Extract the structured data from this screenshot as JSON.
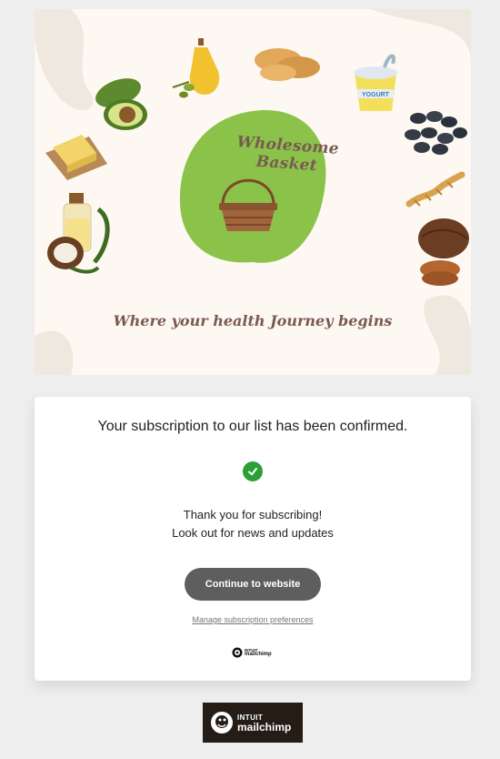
{
  "banner": {
    "brand_name": "Wholesome Basket",
    "tagline": "Where your health Journey begins",
    "bottle_label": "YOGURT"
  },
  "card": {
    "confirmation_message": "Your subscription to our list has been confirmed.",
    "thanks_line_1": "Thank you for subscribing!",
    "thanks_line_2": "Look out for news and updates",
    "continue_label": "Continue to website",
    "manage_label": "Manage subscription preferences",
    "small_logo_intuit": "INTUIT",
    "small_logo_mailchimp": "mailchimp"
  },
  "footer": {
    "logo_intuit": "INTUIT",
    "logo_mailchimp": "mailchimp"
  },
  "colors": {
    "banner_bg": "#fdf8f2",
    "blob_green": "#8bc34a",
    "button_bg": "#5e5e5e",
    "check_green": "#2aa035",
    "mailchimp_dark": "#241c15"
  }
}
